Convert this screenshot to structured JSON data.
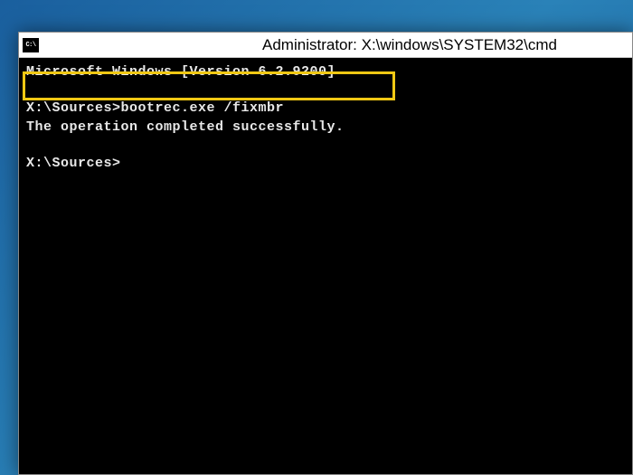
{
  "window": {
    "title": "Administrator: X:\\windows\\SYSTEM32\\cmd",
    "icon_label": "C:\\"
  },
  "terminal": {
    "version_line": "Microsoft Windows [Version 6.2.9200]",
    "blank1": "",
    "prompt1": "X:\\Sources>",
    "command1": "bootrec.exe /fixmbr",
    "result1": "The operation completed successfully.",
    "blank2": "",
    "prompt2": "X:\\Sources>"
  }
}
